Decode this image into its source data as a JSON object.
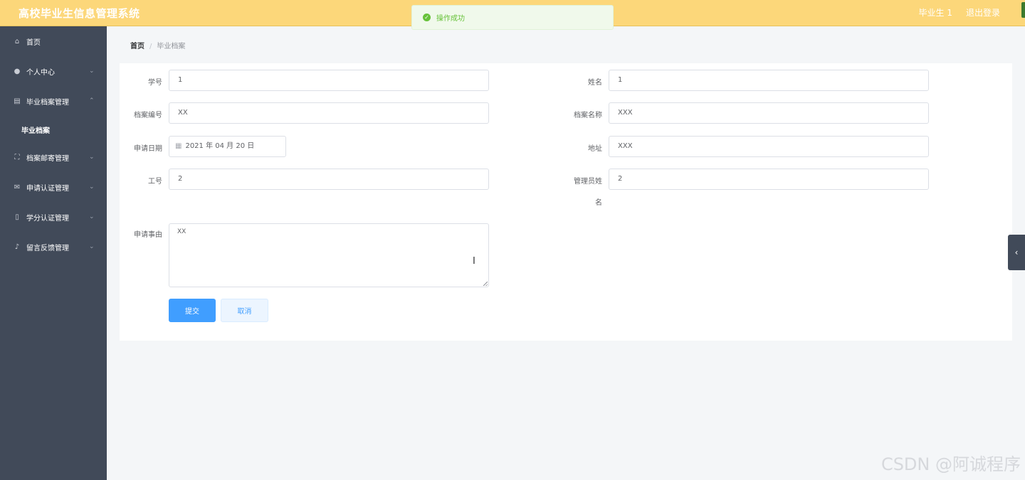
{
  "header": {
    "app_title": "高校毕业生信息管理系统",
    "user_name": "毕业生 1",
    "logout": "退出登录"
  },
  "toast": {
    "icon": "success-check-icon",
    "text": "操作成功"
  },
  "sidebar": {
    "items": [
      {
        "label": "首页",
        "icon": "home-icon"
      },
      {
        "label": "个人中心",
        "icon": "user-icon",
        "arrow": "chevron-down"
      },
      {
        "label": "毕业档案管理",
        "icon": "clipboard-icon",
        "arrow": "chevron-up"
      },
      {
        "label": "档案邮寄管理",
        "icon": "fullscreen-icon",
        "arrow": "chevron-down"
      },
      {
        "label": "申请认证管理",
        "icon": "mail-icon",
        "arrow": "chevron-down"
      },
      {
        "label": "学分认证管理",
        "icon": "phone-icon",
        "arrow": "chevron-down"
      },
      {
        "label": "留言反馈管理",
        "icon": "microphone-icon",
        "arrow": "chevron-down"
      }
    ],
    "sub_item": "毕业档案"
  },
  "breadcrumb": {
    "home": "首页",
    "separator": "/",
    "current": "毕业档案"
  },
  "form": {
    "student_id": {
      "label": "学号",
      "value": "1"
    },
    "name": {
      "label": "姓名",
      "value": "1"
    },
    "archive_no": {
      "label": "档案编号",
      "value": "XX"
    },
    "archive_name": {
      "label": "档案名称",
      "value": "XXX"
    },
    "apply_date": {
      "label": "申请日期",
      "value": "2021 年 04 月 20 日"
    },
    "address": {
      "label": "地址",
      "value": "XXX"
    },
    "staff_no": {
      "label": "工号",
      "value": "2"
    },
    "admin_name": {
      "label_line1": "管理员姓",
      "label_line2": "名",
      "value": "2"
    },
    "reason": {
      "label": "申请事由",
      "value": "XX"
    },
    "submit": "提交",
    "cancel": "取消"
  },
  "watermark": "CSDN @阿诚程序",
  "colors": {
    "header_bg": "#fcd77a",
    "sidebar_bg": "#414a59",
    "primary": "#409eff",
    "success": "#67c23a"
  }
}
